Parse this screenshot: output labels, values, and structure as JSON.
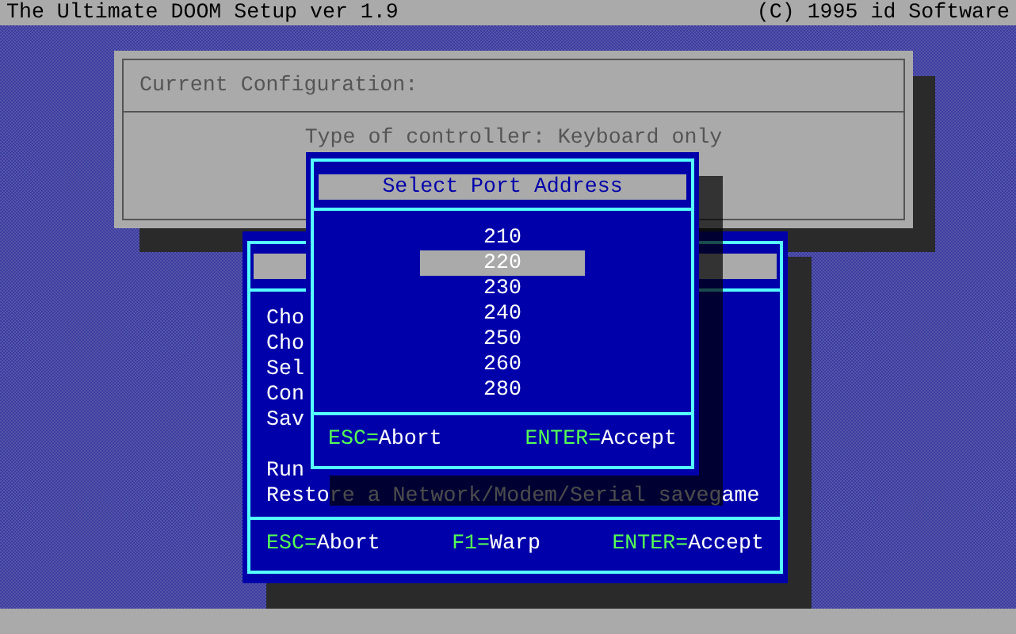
{
  "title_bar": {
    "title": "The Ultimate DOOM Setup ver 1.9",
    "copyright": "(C) 1995 id Software"
  },
  "config_window": {
    "heading": "Current Configuration:",
    "controller": "Type of controller: Keyboard only"
  },
  "main_menu": {
    "item_groups": [
      [
        {
          "label": "Cho"
        },
        {
          "label": "Cho"
        },
        {
          "label": "Sel"
        },
        {
          "label": "Con"
        },
        {
          "label": "Sav"
        }
      ],
      [
        {
          "label": "Run"
        },
        {
          "label": "Restore a Network/Modem/Serial savegame"
        }
      ]
    ],
    "footer": [
      {
        "key": "ESC=",
        "action": "Abort"
      },
      {
        "key": "F1=",
        "action": "Warp"
      },
      {
        "key": "ENTER=",
        "action": "Accept"
      }
    ]
  },
  "port_dialog": {
    "title": "Select Port Address",
    "options": [
      {
        "label": "210",
        "selected": false
      },
      {
        "label": "220",
        "selected": true
      },
      {
        "label": "230",
        "selected": false
      },
      {
        "label": "240",
        "selected": false
      },
      {
        "label": "250",
        "selected": false
      },
      {
        "label": "260",
        "selected": false
      },
      {
        "label": "280",
        "selected": false
      }
    ],
    "footer": [
      {
        "key": "ESC=",
        "action": "Abort"
      },
      {
        "key": "ENTER=",
        "action": "Accept"
      }
    ]
  }
}
